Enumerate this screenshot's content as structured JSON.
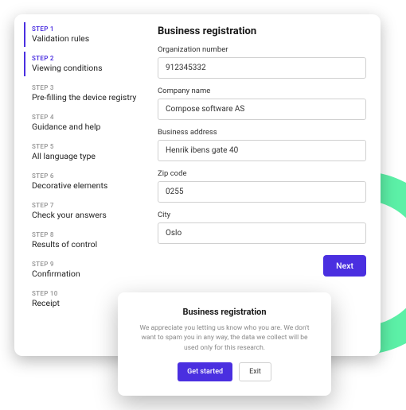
{
  "sidebar": {
    "steps": [
      {
        "label": "STEP 1",
        "title": "Validation rules",
        "active": true
      },
      {
        "label": "STEP 2",
        "title": "Viewing conditions",
        "active": true
      },
      {
        "label": "STEP 3",
        "title": "Pre-filling the device registry",
        "active": false
      },
      {
        "label": "STEP 4",
        "title": "Guidance and help",
        "active": false
      },
      {
        "label": "STEP 5",
        "title": "All language type",
        "active": false
      },
      {
        "label": "STEP 6",
        "title": "Decorative elements",
        "active": false
      },
      {
        "label": "STEP 7",
        "title": "Check your answers",
        "active": false
      },
      {
        "label": "STEP 8",
        "title": "Results of control",
        "active": false
      },
      {
        "label": "STEP 9",
        "title": "Confirmation",
        "active": false
      },
      {
        "label": "STEP 10",
        "title": "Receipt",
        "active": false
      }
    ]
  },
  "main": {
    "title": "Business registration",
    "fields": [
      {
        "label": "Organization number",
        "value": "912345332"
      },
      {
        "label": "Company name",
        "value": "Compose software AS"
      },
      {
        "label": "Business address",
        "value": "Henrik ibens gate 40"
      },
      {
        "label": "Zip code",
        "value": "0255"
      },
      {
        "label": "City",
        "value": "Oslo"
      }
    ],
    "next": "Next"
  },
  "modal": {
    "title": "Business registration",
    "text": "We appreciate you letting us know who you are. We don't want to spam you in any way, the data we collect will be used only for this research.",
    "primary": "Get started",
    "secondary": "Exit"
  }
}
